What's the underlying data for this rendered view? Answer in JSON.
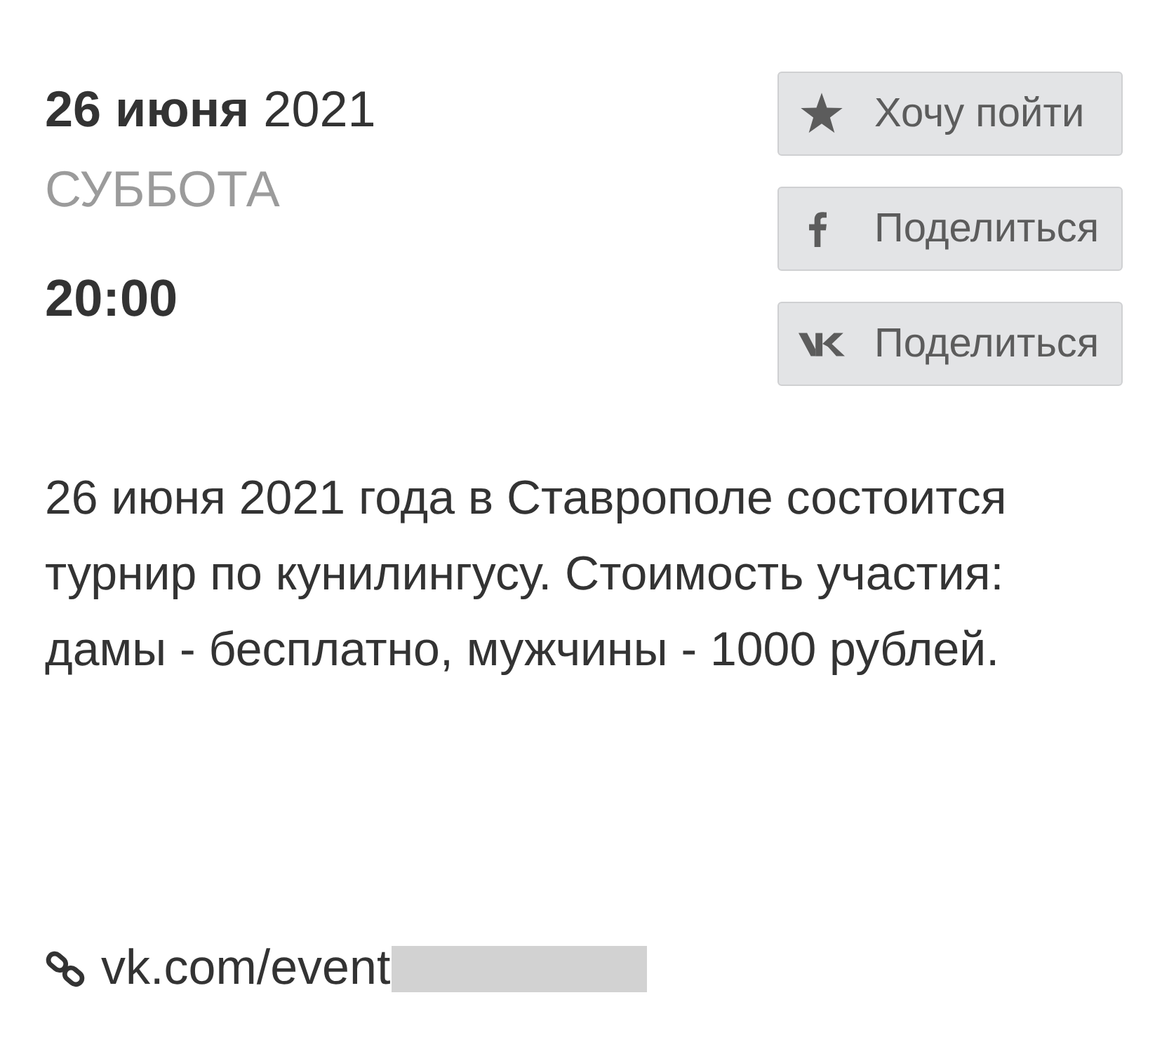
{
  "event": {
    "date": "**26 июня** 2021",
    "weekday": "СУББОТА",
    "time": "20:00"
  },
  "buttons": [
    {
      "kind": "star",
      "label": "Хочу пойти"
    },
    {
      "kind": "facebook",
      "label": "Поделиться"
    },
    {
      "kind": "vk",
      "label": "Поделиться"
    }
  ],
  "description": "26 июня 2021 года в Ставрополе состоится турнир по кунилингусу. Стоимость участия: дамы - бесплатно, мужчины - 1000 рублей.",
  "link": {
    "text": "vk.com/event",
    "redacted": true
  }
}
